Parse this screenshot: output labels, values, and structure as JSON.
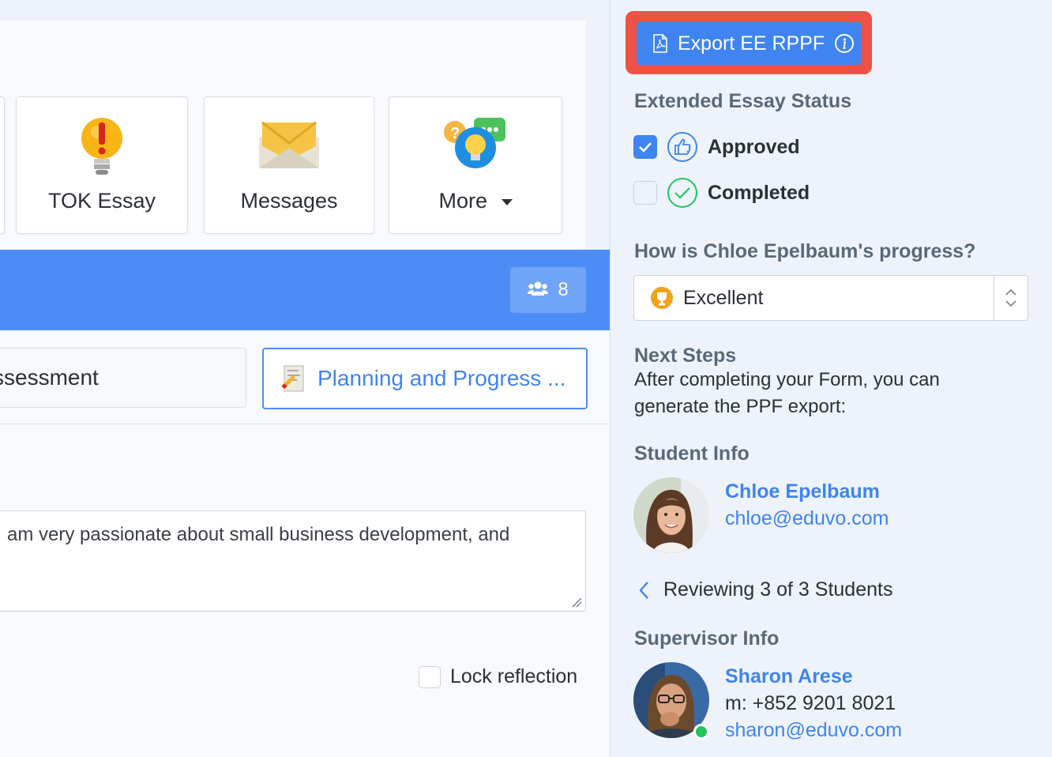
{
  "tiles": [
    {
      "label": "TOK Essay",
      "icon": "lightbulb-alert-icon"
    },
    {
      "label": "Messages",
      "icon": "envelope-icon"
    },
    {
      "label": "More",
      "icon": "idea-chat-icon"
    }
  ],
  "members": {
    "count": "8",
    "icon": "users-icon"
  },
  "tabs": {
    "assessment_label": "ssessment",
    "planning_label": "Planning and Progress ..."
  },
  "reflection": {
    "text": "am very passionate about small business development, and",
    "lock_label": "Lock reflection"
  },
  "sidebar": {
    "export_label": "Export EE RPPF",
    "status_title": "Extended Essay Status",
    "approved_label": "Approved",
    "completed_label": "Completed",
    "progress_question": "How is Chloe Epelbaum's progress?",
    "progress_value": "Excellent",
    "next_steps_title": "Next Steps",
    "next_steps_line1": "After completing your Form, you can",
    "next_steps_line2": "generate the PPF export:",
    "student_info_title": "Student Info",
    "student_name": "Chloe Epelbaum",
    "student_email": "chloe@eduvo.com",
    "reviewing_text": "Reviewing 3 of 3 Students",
    "supervisor_info_title": "Supervisor Info",
    "supervisor_name": "Sharon Arese",
    "supervisor_phone": "m: +852 9201 8021",
    "supervisor_email": "sharon@eduvo.com"
  },
  "colors": {
    "accent": "#3f84f0",
    "band": "#4c8df5",
    "highlight": "#ee5247",
    "success": "#22c55e"
  }
}
